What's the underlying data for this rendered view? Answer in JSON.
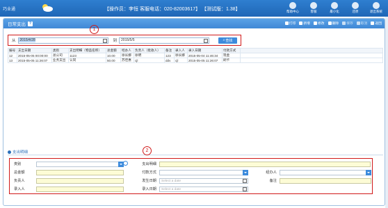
{
  "app": {
    "logo_text": "巧业通",
    "user_info": "【操作员：李恒  客服电话：020-82003617】 【测试版：1.38】",
    "top_actions": [
      {
        "icon": "speaker-icon",
        "label": "帮助中心"
      },
      {
        "icon": "chat-icon",
        "label": "客服"
      },
      {
        "icon": "minimize-icon",
        "label": "最小化"
      },
      {
        "icon": "refresh-icon",
        "label": "还原"
      },
      {
        "icon": "exit-icon",
        "label": "退出系统"
      }
    ]
  },
  "panel": {
    "title": "日常支出",
    "help": "?",
    "toolbar": [
      {
        "icon": "print-icon",
        "label": "打印"
      },
      {
        "icon": "add-icon",
        "label": "新增"
      },
      {
        "icon": "edit-icon",
        "label": "修改"
      },
      {
        "icon": "delete-icon",
        "label": "删除"
      },
      {
        "icon": "save-icon",
        "label": "保存"
      },
      {
        "icon": "cancel-icon",
        "label": "取消"
      },
      {
        "icon": "back-icon",
        "label": "返回"
      }
    ]
  },
  "search": {
    "from_label": "从",
    "from_value": "2015/4/28",
    "to_label": "到",
    "to_value": "2015/5/5",
    "button_label": "查找"
  },
  "annotations": {
    "one": "1",
    "two": "2"
  },
  "table": {
    "headers": [
      "编号",
      "支出日期",
      "类别",
      "支出明细（物品名称）",
      "总金额",
      "经办人",
      "负责人（批收人）",
      "备注",
      "录入人",
      "录入日期",
      "付款方式"
    ],
    "rows": [
      [
        "12",
        "2015-05-05 00:00:00",
        "总公司",
        "1123",
        "10.00",
        "徐长娜",
        "徐明",
        "123",
        "徐长娜",
        "2015-05-04 11:46:34",
        "现金"
      ],
      [
        "13",
        "2015-05-05 11:26:07",
        "业务支出",
        "认同",
        "50.00",
        "苏佳惠",
        "cjl",
        "ddv",
        "cjl",
        "2015-05-05 11:26:07",
        "刷卡"
      ]
    ]
  },
  "detail": {
    "title": "支出明细",
    "fields": {
      "category": {
        "label": "类别",
        "value": ""
      },
      "expense_detail": {
        "label": "支出明细",
        "value": ""
      },
      "total": {
        "label": "总金额",
        "value": ""
      },
      "payment": {
        "label": "付款方式",
        "value": ""
      },
      "handler": {
        "label": "经办人",
        "value": ""
      },
      "owner": {
        "label": "负责人",
        "value": ""
      },
      "expense_date": {
        "label": "发生日期",
        "placeholder": "Select a date"
      },
      "remark": {
        "label": "备注",
        "value": ""
      },
      "entry_user": {
        "label": "录入人",
        "value": ""
      },
      "entry_date": {
        "label": "录入日期",
        "placeholder": "Select a date"
      }
    }
  },
  "colors": {
    "accent": "#3d8bdc",
    "annotation": "#d01818",
    "required_field": "#fdfcd6"
  }
}
